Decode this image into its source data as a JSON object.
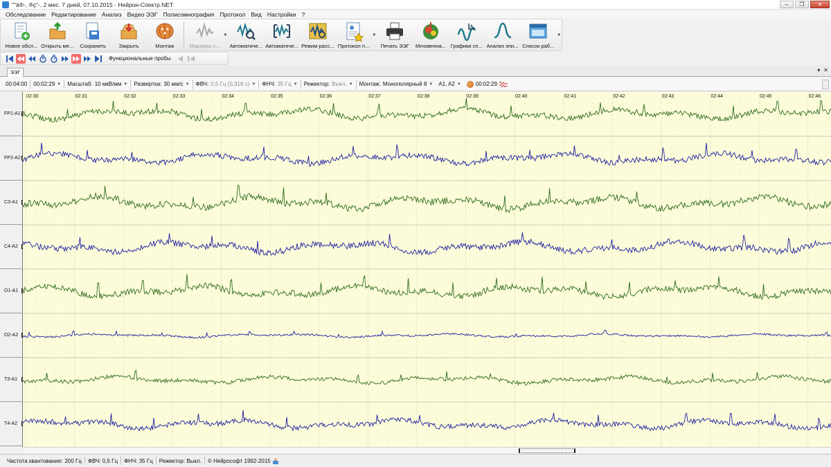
{
  "window": {
    "title": "\"\"ä®-, ®ç\"-, 2 мес. 7 дней, 07.10.2015 - Нейрон-Спектр.NET",
    "controls": [
      "–",
      "❐",
      "✕"
    ]
  },
  "menu": [
    "Обследование",
    "Редактирование",
    "Анализ",
    "Видео ЭЭГ",
    "Полисомнография",
    "Протокол",
    "Вид",
    "Настройки",
    "?"
  ],
  "toolbar": {
    "tools": [
      {
        "label": "Новое обсл...",
        "icon": "new-exam-icon"
      },
      {
        "label": "Открыть ме...",
        "icon": "open-icon"
      },
      {
        "label": "Сохранить",
        "icon": "save-icon"
      },
      {
        "label": "Закрыть",
        "icon": "close-exam-icon"
      },
      {
        "label": "Монтаж",
        "icon": "brain-montage-icon"
      },
      {
        "label": "Маркеры с...",
        "icon": "markers-icon",
        "disabled": true
      },
      {
        "label": "Автоматиче...",
        "icon": "auto-analysis-icon"
      },
      {
        "label": "Автоматиче...",
        "icon": "auto-detect-icon"
      },
      {
        "label": "Режим расс...",
        "icon": "view-mode-icon"
      },
      {
        "label": "Протокол п...",
        "icon": "protocol-icon"
      },
      {
        "label": "Печать ЭЭГ",
        "icon": "printer-icon"
      },
      {
        "label": "Мгновенна...",
        "icon": "instant-map-icon"
      },
      {
        "label": "Графики сп...",
        "icon": "spectrum-graph-icon"
      },
      {
        "label": "Анализ эпи...",
        "icon": "epi-analysis-icon"
      },
      {
        "label": "Список раб...",
        "icon": "window-list-icon"
      }
    ]
  },
  "navbar": {
    "functional_tests_label": "Функциональные пробы"
  },
  "tab": {
    "label": "ЭЭГ"
  },
  "params": {
    "duration": "00:04:00",
    "position": "00:02:29",
    "scale_label": "Масштаб:",
    "scale_value": "10 мкВ/мм",
    "sweep_label": "Развертка:",
    "sweep_value": "30 мм/с",
    "hpf_label": "ФВЧ:",
    "hpf_value": "0,5 Гц (0,318 с)",
    "lpf_label": "ФНЧ:",
    "lpf_value": "35 Гц",
    "notch_label": "Режектор:",
    "notch_value": "Выкл.",
    "montage_label": "Монтаж:",
    "montage_value": "Монополярный 8",
    "refs": "A1, A2",
    "time": "00:02:29"
  },
  "time_axis": [
    "02:30",
    "02:31",
    "02:32",
    "02:33",
    "02:34",
    "02:35",
    "02:36",
    "02:37",
    "02:38",
    "02:39",
    "02:40",
    "02:41",
    "02:42",
    "02:43",
    "02:44",
    "02:45",
    "02:46"
  ],
  "channels": [
    {
      "name": "FP1-A1",
      "color": "#2e6b1e"
    },
    {
      "name": "FP2-A2",
      "color": "#1f1fa0"
    },
    {
      "name": "C3-A1",
      "color": "#2e6b1e"
    },
    {
      "name": "C4-A2",
      "color": "#1f1fa0"
    },
    {
      "name": "O1-A1",
      "color": "#2e6b1e"
    },
    {
      "name": "O2-A2",
      "color": "#1f1fa0"
    },
    {
      "name": "T3-A1",
      "color": "#2e6b1e"
    },
    {
      "name": "T4-A2",
      "color": "#1f1fa0"
    }
  ],
  "status": {
    "sampling_label": "Частота квантования:",
    "sampling_value": "200 Гц",
    "hpf": "ФВЧ: 0,5 Гц",
    "lpf": "ФНЧ: 35 Гц",
    "notch": "Режектор: Выкл.",
    "copyright": "© Нейрософт 1992-2015"
  },
  "colors": {
    "eeg_background": "#fcfcda",
    "grid_dots": "#c9c9a0",
    "second_lines": "#c0c0a0"
  }
}
